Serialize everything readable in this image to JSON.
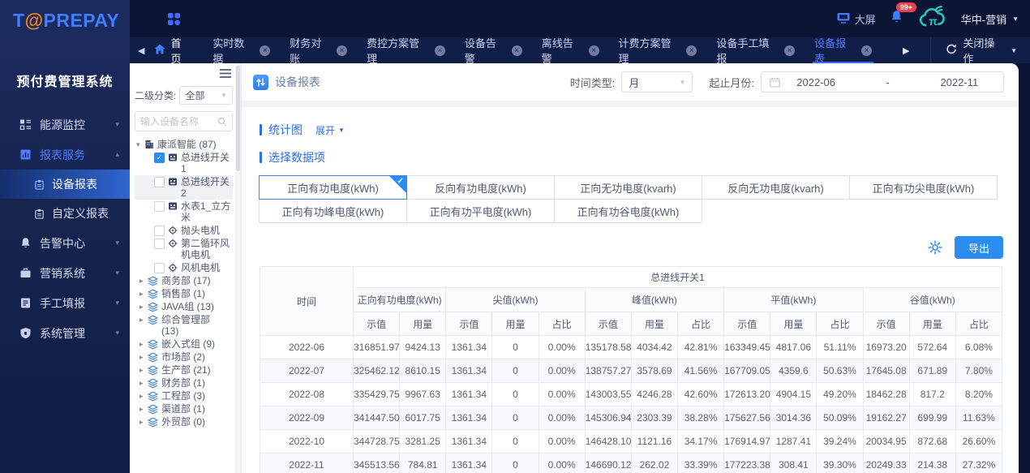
{
  "app": {
    "logo_t": "T",
    "logo_at": "@",
    "logo_rest": "PREPAY",
    "subtitle": "预付费管理系统"
  },
  "topbar": {
    "big_screen": "大屏",
    "badge": "99+",
    "user": "华中-营销"
  },
  "tabbar": {
    "home": "首页",
    "tabs": [
      "实时数据",
      "财务对账",
      "费控方案管理",
      "设备告警",
      "离线告警",
      "计费方案管理",
      "设备手工填报",
      "设备报表"
    ],
    "active_tab": "设备报表",
    "close_action": "关闭操作"
  },
  "sidebar": {
    "items": [
      {
        "label": "能源监控"
      },
      {
        "label": "报表服务"
      },
      {
        "label": "告警中心"
      },
      {
        "label": "营销系统"
      },
      {
        "label": "手工填报"
      },
      {
        "label": "系统管理"
      }
    ],
    "sub_items": [
      {
        "label": "设备报表"
      },
      {
        "label": "自定义报表"
      }
    ]
  },
  "tree": {
    "category_label": "二级分类:",
    "category_value": "全部",
    "search_placeholder": "输入设备名称",
    "root_label": "康派智能 (87)",
    "devices": [
      {
        "label": "总进线开关1",
        "checked": true,
        "icon": "meter",
        "highlight": false
      },
      {
        "label": "总进线开关2",
        "checked": false,
        "icon": "meter",
        "highlight": true
      },
      {
        "label": "水表1_立方米",
        "checked": false,
        "icon": "meter",
        "highlight": false
      },
      {
        "label": "抛头电机",
        "checked": false,
        "icon": "motor",
        "highlight": false
      },
      {
        "label": "第二循环风机电机",
        "checked": false,
        "icon": "motor",
        "highlight": false
      },
      {
        "label": "风机电机",
        "checked": false,
        "icon": "motor",
        "highlight": false
      }
    ],
    "groups": [
      "商务部 (17)",
      "销售部 (1)",
      "JAVA组 (13)",
      "综合管理部 (13)",
      "嵌入式组 (9)",
      "市场部 (2)",
      "生产部 (21)",
      "财务部 (1)",
      "工程部 (3)",
      "渠道部 (1)",
      "外贸部 (0)"
    ]
  },
  "main": {
    "title": "设备报表",
    "time_type_label": "时间类型:",
    "time_type_value": "月",
    "range_label": "起止月份:",
    "range_start": "2022-06",
    "range_separator": "-",
    "range_end": "2022-11",
    "chart_section_title": "统计图",
    "expand_label": "展开",
    "data_items_title": "选择数据项",
    "data_items": [
      "正向有功电度(kWh)",
      "反向有功电度(kWh)",
      "正向无功电度(kvarh)",
      "反向无功电度(kvarh)",
      "正向有功尖电度(kWh)",
      "正向有功峰电度(kWh)",
      "正向有功平电度(kWh)",
      "正向有功谷电度(kWh)"
    ],
    "selected_item": "正向有功电度(kWh)",
    "export_label": "导出"
  },
  "table": {
    "device_header": "总进线开关1",
    "time_header": "时间",
    "groups": [
      {
        "label": "正向有功电度(kWh)",
        "cols": [
          "示值",
          "用量"
        ]
      },
      {
        "label": "尖值(kWh)",
        "cols": [
          "示值",
          "用量",
          "占比"
        ]
      },
      {
        "label": "峰值(kWh)",
        "cols": [
          "示值",
          "用量",
          "占比"
        ]
      },
      {
        "label": "平值(kWh)",
        "cols": [
          "示值",
          "用量",
          "占比"
        ]
      },
      {
        "label": "谷值(kWh)",
        "cols": [
          "示值",
          "用量",
          "占比"
        ]
      }
    ],
    "rows": [
      [
        "2022-06",
        "316851.97",
        "9424.13",
        "1361.34",
        "0",
        "0.00%",
        "135178.58",
        "4034.42",
        "42.81%",
        "163349.45",
        "4817.06",
        "51.11%",
        "16973.20",
        "572.64",
        "6.08%"
      ],
      [
        "2022-07",
        "325462.12",
        "8610.15",
        "1361.34",
        "0",
        "0.00%",
        "138757.27",
        "3578.69",
        "41.56%",
        "167709.05",
        "4359.6",
        "50.63%",
        "17645.08",
        "671.89",
        "7.80%"
      ],
      [
        "2022-08",
        "335429.75",
        "9967.63",
        "1361.34",
        "0",
        "0.00%",
        "143003.55",
        "4246.28",
        "42.60%",
        "172613.20",
        "4904.15",
        "49.20%",
        "18462.28",
        "817.2",
        "8.20%"
      ],
      [
        "2022-09",
        "341447.50",
        "6017.75",
        "1361.34",
        "0",
        "0.00%",
        "145306.94",
        "2303.39",
        "38.28%",
        "175627.56",
        "3014.36",
        "50.09%",
        "19162.27",
        "699.99",
        "11.63%"
      ],
      [
        "2022-10",
        "344728.75",
        "3281.25",
        "1361.34",
        "0",
        "0.00%",
        "146428.10",
        "1121.16",
        "34.17%",
        "176914.97",
        "1287.41",
        "39.24%",
        "20034.95",
        "872.68",
        "26.60%"
      ],
      [
        "2022-11",
        "345513.56",
        "784.81",
        "1361.34",
        "0",
        "0.00%",
        "146690.12",
        "262.02",
        "33.39%",
        "177223.38",
        "308.41",
        "39.30%",
        "20249.33",
        "214.38",
        "27.32%"
      ]
    ]
  },
  "colors": {
    "accent": "#2d8cf0",
    "tab_active": "#4d7cff",
    "badge_red": "#f0404f",
    "teal_logo": "#28c8c0",
    "dark_bg": "#0c1634"
  }
}
